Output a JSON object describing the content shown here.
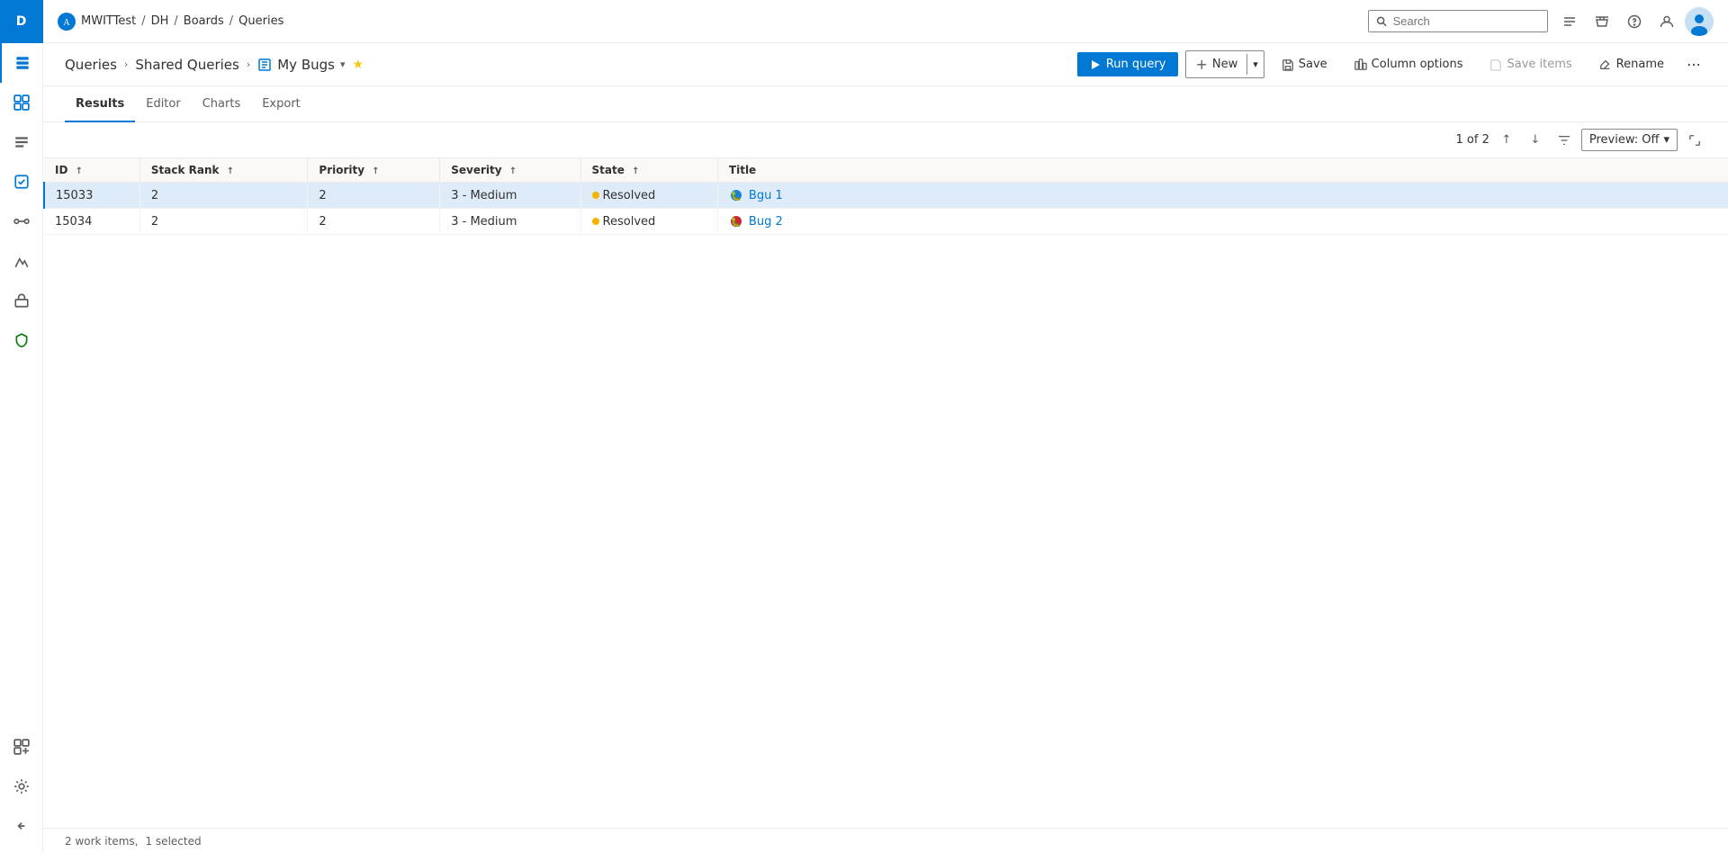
{
  "topbar": {
    "logo_text": "A",
    "breadcrumbs": [
      {
        "label": "MWITTest",
        "sep": "/"
      },
      {
        "label": "DH",
        "sep": "/"
      },
      {
        "label": "Boards",
        "sep": "/"
      },
      {
        "label": "Queries",
        "sep": ""
      }
    ],
    "search_placeholder": "Search"
  },
  "sidebar": {
    "logo": "D",
    "icons": [
      {
        "name": "home-icon",
        "symbol": "⌂"
      },
      {
        "name": "summary-icon",
        "symbol": "☰"
      },
      {
        "name": "boards-icon",
        "symbol": "⊞"
      },
      {
        "name": "work-items-icon",
        "symbol": "📋"
      },
      {
        "name": "pipelines-icon",
        "symbol": "↔"
      },
      {
        "name": "test-plans-icon",
        "symbol": "🧪"
      },
      {
        "name": "artifacts-icon",
        "symbol": "📦"
      },
      {
        "name": "security-icon",
        "symbol": "🛡"
      }
    ]
  },
  "header": {
    "queries_label": "Queries",
    "shared_queries_label": "Shared Queries",
    "query_icon": "☰",
    "query_name": "My Bugs",
    "run_query_label": "Run query",
    "new_label": "New",
    "save_label": "Save",
    "column_options_label": "Column options",
    "save_items_label": "Save items",
    "rename_label": "Rename"
  },
  "tabs": [
    {
      "label": "Results",
      "active": true
    },
    {
      "label": "Editor",
      "active": false
    },
    {
      "label": "Charts",
      "active": false
    },
    {
      "label": "Export",
      "active": false
    }
  ],
  "pagination": {
    "text": "1 of 2",
    "preview_label": "Preview: Off"
  },
  "table": {
    "columns": [
      {
        "label": "ID",
        "sort": "↑"
      },
      {
        "label": "Stack Rank",
        "sort": "↑"
      },
      {
        "label": "Priority",
        "sort": "↑"
      },
      {
        "label": "Severity",
        "sort": "↑"
      },
      {
        "label": "State",
        "sort": "↑"
      },
      {
        "label": "Title",
        "sort": ""
      }
    ],
    "rows": [
      {
        "id": "15033",
        "stack_rank": "2",
        "priority": "2",
        "severity": "3 - Medium",
        "state": "Resolved",
        "title": "Bgu 1",
        "selected": true
      },
      {
        "id": "15034",
        "stack_rank": "2",
        "priority": "2",
        "severity": "3 - Medium",
        "state": "Resolved",
        "title": "Bug 2",
        "selected": false
      }
    ]
  },
  "status_bar": {
    "work_items_label": "2 work items,",
    "selected_label": "1 selected"
  }
}
